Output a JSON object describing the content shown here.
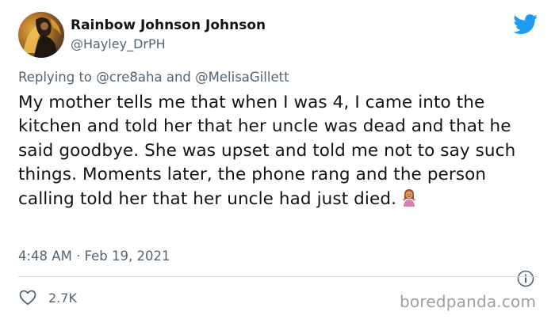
{
  "user": {
    "display_name": "Rainbow Johnson Johnson",
    "handle": "@Hayley_DrPH"
  },
  "reply": {
    "prefix": "Replying to",
    "mentions": [
      "@cre8aha",
      "@MelisaGillett"
    ],
    "joiner": "and"
  },
  "tweet": {
    "text": "My mother tells me that when I was 4, I came into the kitchen and told her that her uncle was dead and that he said goodbye. She was upset and told me not to say such things. Moments later, the phone rang and the person calling told her that her uncle had just died.",
    "timestamp": "4:48 AM · Feb 19, 2021"
  },
  "actions": {
    "like_count": "2.7K"
  },
  "watermark": "boredpanda.com",
  "colors": {
    "twitter_blue": "#1d9bf0",
    "muted_text": "#536471",
    "divider": "#cfd9de"
  },
  "icons": {
    "brand": "twitter-bird-icon",
    "info": "info-icon",
    "like": "heart-outline-icon",
    "emoji": "person-shrugging-emoji"
  }
}
